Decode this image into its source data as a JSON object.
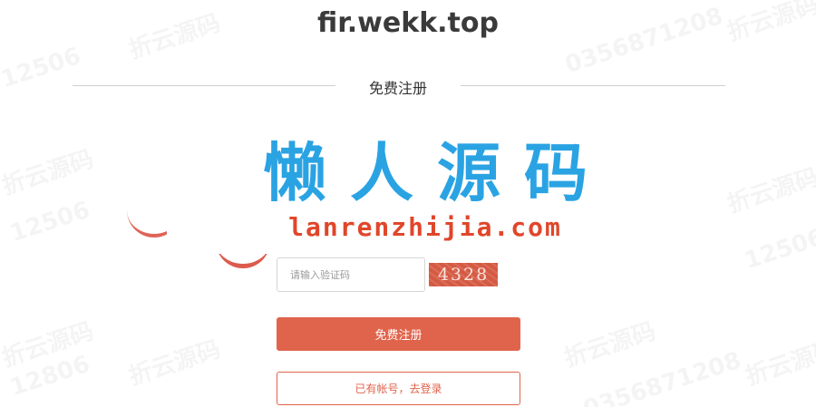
{
  "header": {
    "title": "fir.wekk.top"
  },
  "divider": {
    "label": "免费注册"
  },
  "banner": {
    "title_cn": "懒人源码",
    "url": "lanrenzhijia.com"
  },
  "form": {
    "code_placeholder": "请输入验证码",
    "captcha_text": "4328",
    "register_label": "免费注册",
    "login_label": "已有帐号，去登录"
  },
  "colors": {
    "accent": "#e0644c",
    "banner_blue": "#2aa3e3",
    "banner_red": "#e0462a"
  }
}
